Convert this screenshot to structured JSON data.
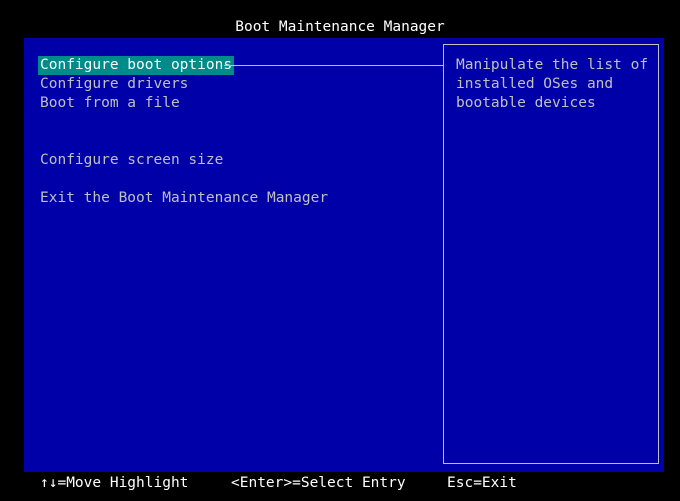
{
  "header": {
    "title": "Boot Maintenance Manager"
  },
  "menu": {
    "items": [
      {
        "label": "Configure boot options",
        "selected": true
      },
      {
        "label": "Configure drivers"
      },
      {
        "label": "Boot from a file"
      },
      {
        "label": "Configure screen size"
      },
      {
        "label": "Exit the Boot Maintenance Manager"
      }
    ]
  },
  "help": {
    "lines": [
      "Manipulate the list of",
      "installed OSes and",
      "bootable devices"
    ]
  },
  "footer": {
    "move": "↑↓=Move Highlight",
    "select": "<Enter>=Select Entry",
    "exit": "Esc=Exit"
  },
  "colors": {
    "background": "#000000",
    "panel": "#0000a8",
    "highlight": "#008b8b",
    "text": "#c0c0c0",
    "bright_text": "#ffffff"
  }
}
